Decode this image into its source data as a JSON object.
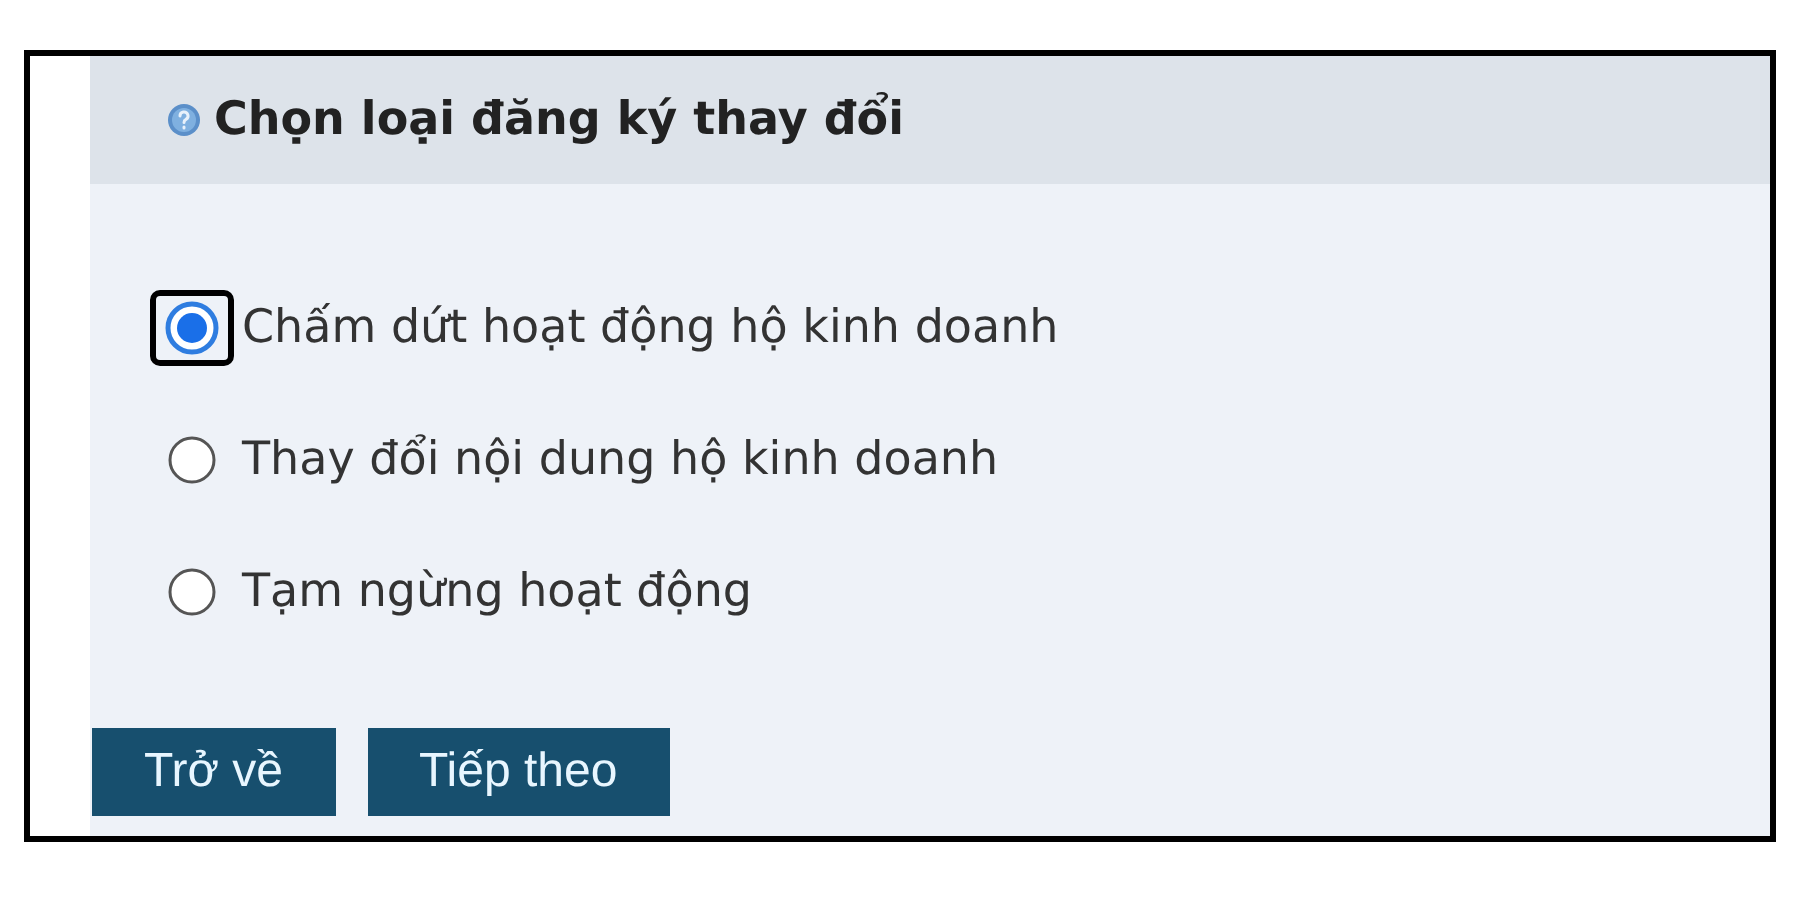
{
  "panel": {
    "title": "Chọn loại đăng ký thay đổi"
  },
  "options": [
    {
      "label": "Chấm dứt hoạt động hộ kinh doanh",
      "selected": true
    },
    {
      "label": "Thay đổi nội dung hộ kinh doanh",
      "selected": false
    },
    {
      "label": "Tạm ngừng hoạt động",
      "selected": false
    }
  ],
  "buttons": [
    "Trở về",
    "Tiếp theo"
  ]
}
